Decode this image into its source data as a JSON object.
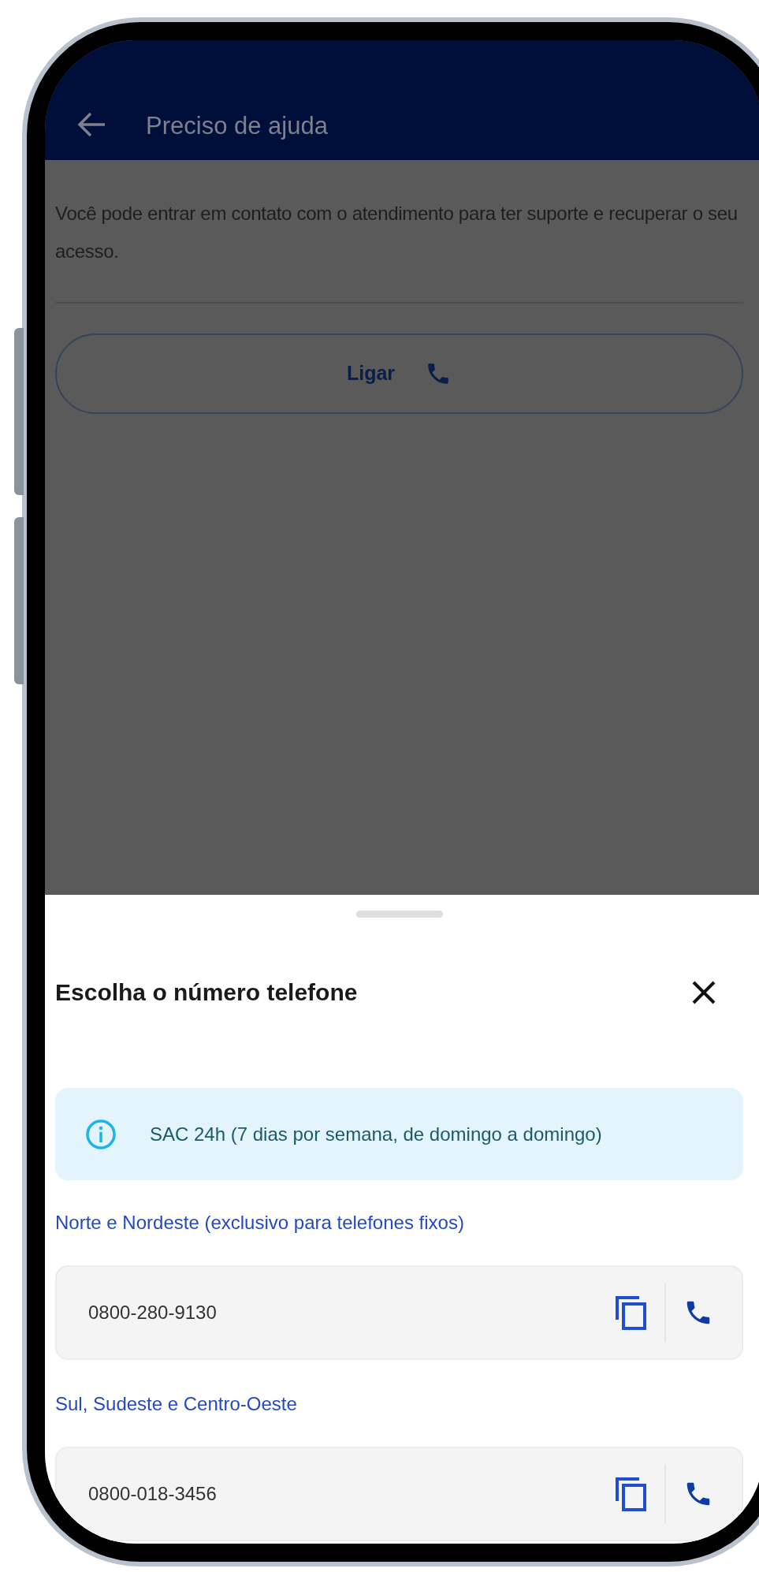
{
  "header": {
    "title": "Preciso de ajuda"
  },
  "description": "Você pode entrar em contato com o atendimento para ter suporte e recuperar o seu acesso.",
  "call_button": {
    "label": "Ligar"
  },
  "sheet": {
    "title": "Escolha o número telefone",
    "info": "SAC 24h (7 dias por semana, de domingo a domingo)",
    "groups": [
      {
        "label": "Norte e Nordeste (exclusivo para telefones fixos)",
        "number": "0800-280-9130"
      },
      {
        "label": "Sul, Sudeste e Centro-Oeste",
        "number": "0800-018-3456"
      }
    ]
  }
}
